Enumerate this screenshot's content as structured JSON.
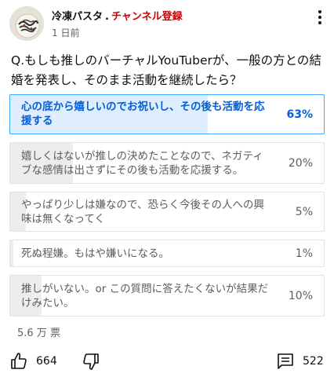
{
  "post": {
    "channel_name": "冷凍パスタ",
    "separator": ".",
    "subscribe_label": "チャンネル登録",
    "time_ago": "1 日前"
  },
  "question": "Q.もしも推しのバーチャルYouTuberが、一般の方との結婚を発表し、そのまま活動を継続したら？",
  "options": [
    {
      "text": "心の底から嬉しいのでお祝いし、その後も活動を応援する",
      "percent": "63%",
      "fraction": 0.63,
      "selected": true
    },
    {
      "text": "嬉しくはないが推しの決めたことなので、ネガティブな感情は出さずにその後も活動を応援する。",
      "percent": "20%",
      "fraction": 0.2,
      "selected": false
    },
    {
      "text": "やっぱり少しは嫌なので、恐らく今後その人への興味は無くなってく",
      "percent": "5%",
      "fraction": 0.05,
      "selected": false
    },
    {
      "text": "死ぬ程嫌。もはや嫌いになる。",
      "percent": "1%",
      "fraction": 0.01,
      "selected": false
    },
    {
      "text": "推しがいない。or この質問に答えたくないが結果だけみたい。",
      "percent": "10%",
      "fraction": 0.1,
      "selected": false
    }
  ],
  "votes_label": "5.6 万 票",
  "actions": {
    "like_count": "664",
    "comment_count": "522"
  },
  "icons": [
    "avatar",
    "more-vert-icon",
    "thumb-up-icon",
    "thumb-down-icon",
    "comment-icon"
  ],
  "colors": {
    "subscribe_red": "#cc0000",
    "selected_blue": "#065fd4",
    "selected_border": "#3ea6ff",
    "selected_fill": "#deeefe",
    "bar_fill": "#ededed"
  }
}
